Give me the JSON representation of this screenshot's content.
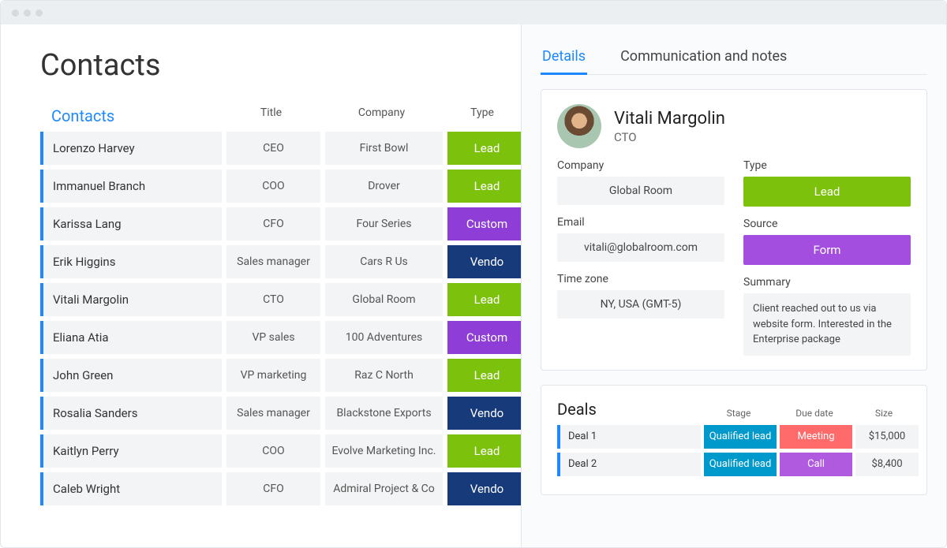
{
  "page_title": "Contacts",
  "contacts_section": {
    "heading": "Contacts",
    "columns": {
      "title": "Title",
      "company": "Company",
      "type": "Type"
    },
    "type_colors": {
      "lead": "#7cc10c",
      "customer": "#8e3ed6",
      "vendor": "#173a7a"
    },
    "rows": [
      {
        "name": "Lorenzo Harvey",
        "title": "CEO",
        "company": "First Bowl",
        "type": "Lead",
        "type_key": "lead"
      },
      {
        "name": "Immanuel Branch",
        "title": "COO",
        "company": "Drover",
        "type": "Lead",
        "type_key": "lead"
      },
      {
        "name": "Karissa Lang",
        "title": "CFO",
        "company": "Four Series",
        "type": "Custom",
        "type_key": "customer"
      },
      {
        "name": "Erik Higgins",
        "title": "Sales manager",
        "company": "Cars R Us",
        "type": "Vendo",
        "type_key": "vendor"
      },
      {
        "name": "Vitali Margolin",
        "title": "CTO",
        "company": "Global Room",
        "type": "Lead",
        "type_key": "lead"
      },
      {
        "name": "Eliana Atia",
        "title": "VP sales",
        "company": "100 Adventures",
        "type": "Custom",
        "type_key": "customer"
      },
      {
        "name": "John Green",
        "title": "VP marketing",
        "company": "Raz C North",
        "type": "Lead",
        "type_key": "lead"
      },
      {
        "name": "Rosalia Sanders",
        "title": "Sales manager",
        "company": "Blackstone Exports",
        "type": "Vendo",
        "type_key": "vendor"
      },
      {
        "name": "Kaitlyn Perry",
        "title": "COO",
        "company": "Evolve Marketing Inc.",
        "type": "Lead",
        "type_key": "lead"
      },
      {
        "name": "Caleb Wright",
        "title": "CFO",
        "company": "Admiral Project & Co",
        "type": "Vendo",
        "type_key": "vendor"
      }
    ]
  },
  "tabs": {
    "details": "Details",
    "notes": "Communication and notes",
    "active": "details"
  },
  "detail_panel": {
    "name": "Vitali Margolin",
    "title": "CTO",
    "labels": {
      "company": "Company",
      "type": "Type",
      "email": "Email",
      "source": "Source",
      "timezone": "Time zone",
      "summary": "Summary"
    },
    "company": "Global Room",
    "type": "Lead",
    "type_key": "lead",
    "email": "vitali@globalroom.com",
    "source": "Form",
    "source_color": "#a44ee0",
    "timezone": "NY, USA (GMT-5)",
    "summary": "Client reached out to us via website form. Interested in the Enterprise package"
  },
  "deals_section": {
    "heading": "Deals",
    "columns": {
      "stage": "Stage",
      "due": "Due date",
      "size": "Size"
    },
    "rows": [
      {
        "name": "Deal 1",
        "stage": "Qualified lead",
        "stage_key": "qlead",
        "due": "Meeting",
        "due_key": "meeting",
        "size": "$15,000"
      },
      {
        "name": "Deal 2",
        "stage": "Qualified lead",
        "stage_key": "qlead",
        "due": "Call",
        "due_key": "call",
        "size": "$8,400"
      }
    ]
  }
}
